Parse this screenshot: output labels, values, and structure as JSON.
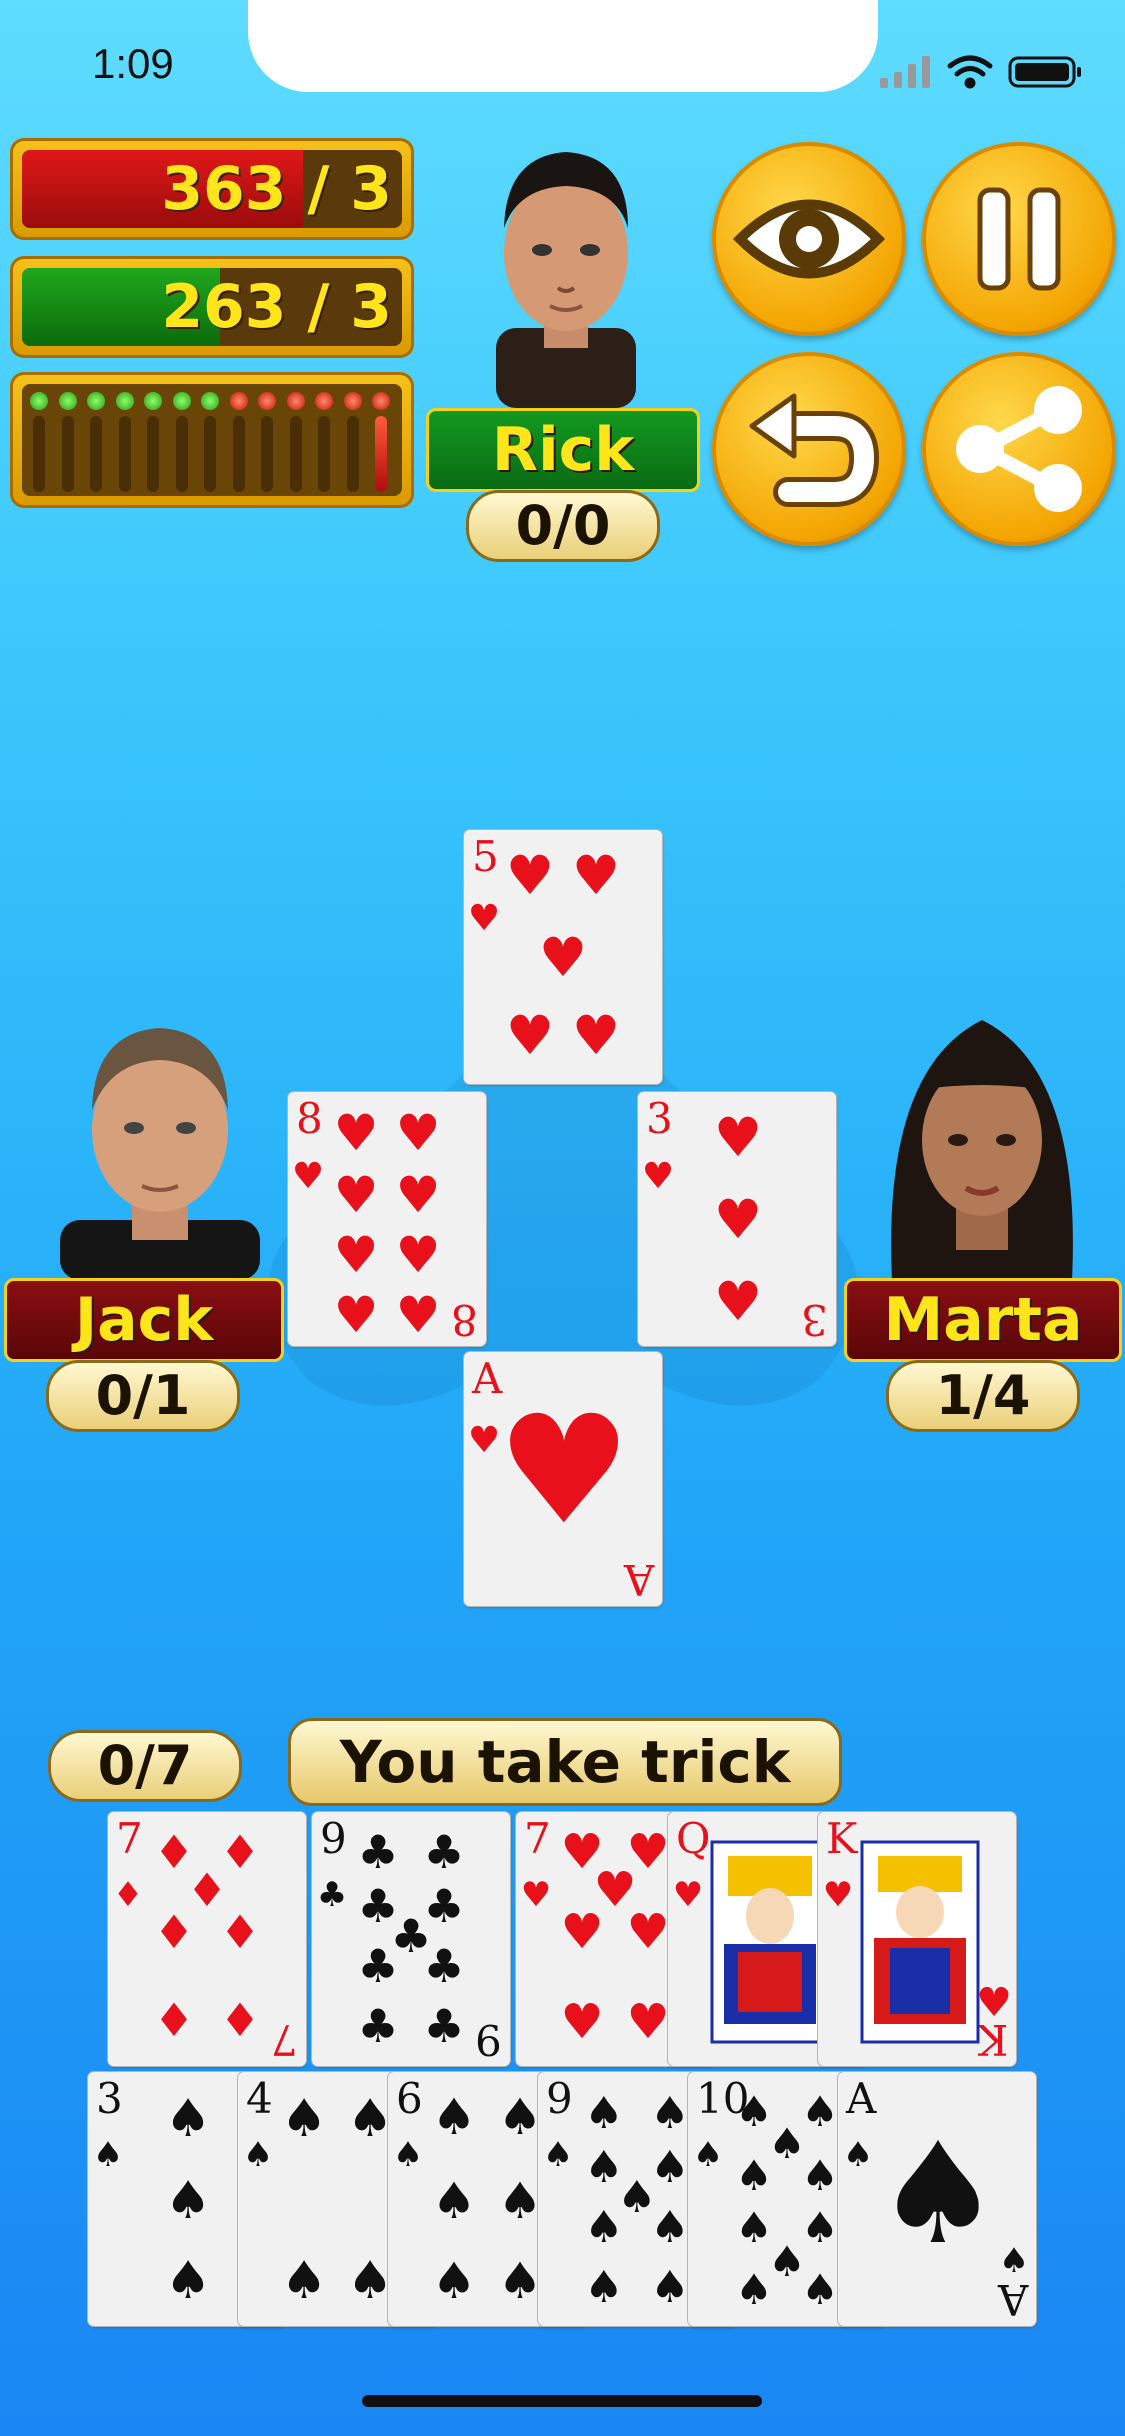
{
  "status_bar": {
    "time": "1:09"
  },
  "scores": {
    "red": {
      "text": "363 / 3",
      "fill": 0.74,
      "color": "#e01818"
    },
    "green": {
      "text": "263 / 3",
      "fill": 0.52,
      "color": "#1fa81c"
    }
  },
  "players": {
    "top": {
      "name": "Rick",
      "tricks": "0/0"
    },
    "left": {
      "name": "Jack",
      "tricks": "0/1"
    },
    "right": {
      "name": "Marta",
      "tricks": "1/4"
    },
    "me": {
      "tricks": "0/7"
    }
  },
  "buttons": {
    "view": "eye-icon",
    "pause": "pause-icon",
    "undo": "undo-icon",
    "share": "share-icon"
  },
  "message": "You take trick",
  "table_cards": {
    "top": {
      "rank": "5",
      "suit": "♥"
    },
    "left": {
      "rank": "8",
      "suit": "♥"
    },
    "right": {
      "rank": "3",
      "suit": "♥"
    },
    "bottom": {
      "rank": "A",
      "suit": "♥"
    }
  },
  "hand_row1": [
    {
      "rank": "7",
      "suit": "♦"
    },
    {
      "rank": "9",
      "suit": "♣"
    },
    {
      "rank": "7",
      "suit": "♥"
    },
    {
      "rank": "Q",
      "suit": "♥"
    },
    {
      "rank": "K",
      "suit": "♥"
    }
  ],
  "hand_row2": [
    {
      "rank": "3",
      "suit": "♠"
    },
    {
      "rank": "4",
      "suit": "♠"
    },
    {
      "rank": "6",
      "suit": "♠"
    },
    {
      "rank": "9",
      "suit": "♠"
    },
    {
      "rank": "10",
      "suit": "♠"
    },
    {
      "rank": "A",
      "suit": "♠"
    }
  ]
}
